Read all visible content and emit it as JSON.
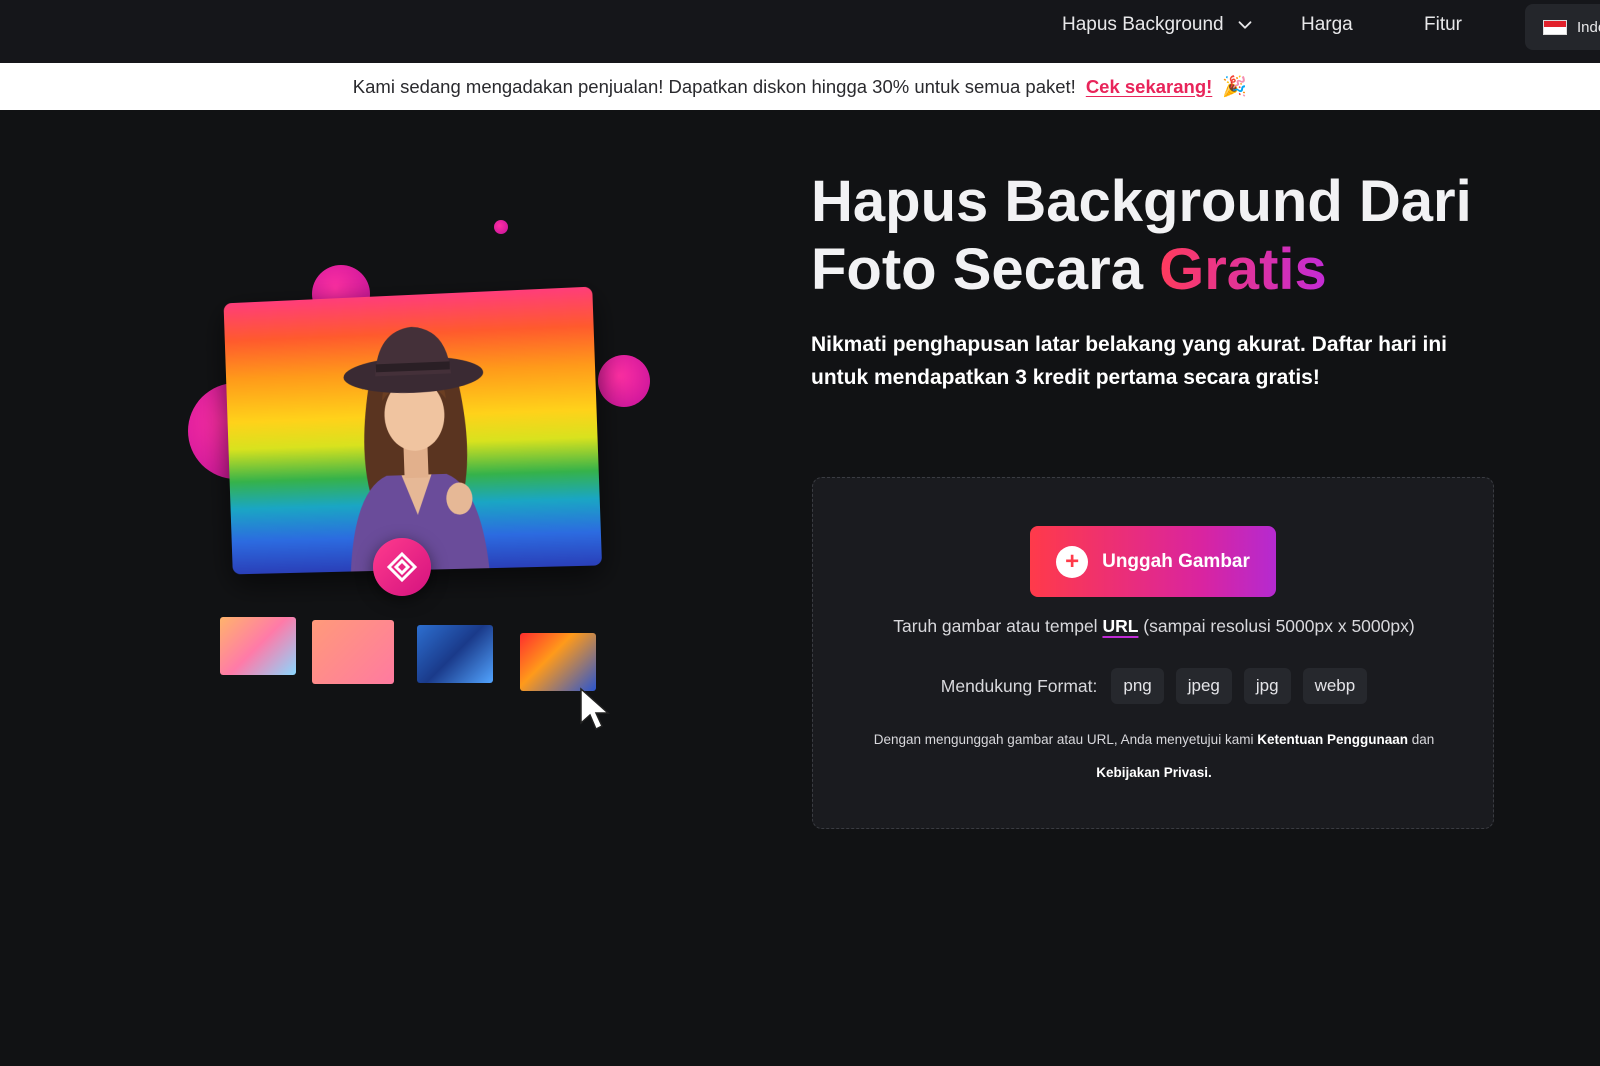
{
  "nav": {
    "items": [
      {
        "label": "Hapus Background"
      },
      {
        "label": "Harga"
      },
      {
        "label": "Fitur"
      }
    ],
    "language": "Indo"
  },
  "promo": {
    "text": "Kami sedang mengadakan penjualan! Dapatkan diskon hingga 30% untuk semua paket!",
    "link": "Cek sekarang!",
    "emoji": "🎉"
  },
  "hero": {
    "title_line1": "Hapus Background Dari",
    "title_line2": "Foto Secara",
    "title_highlight": "Gratis",
    "subtitle": "Nikmati penghapusan latar belakang yang akurat. Daftar hari ini untuk mendapatkan 3 kredit pertama secara gratis!"
  },
  "upload": {
    "button_label": "Unggah Gambar",
    "drop_prefix": "Taruh gambar atau tempel",
    "drop_link": "URL",
    "drop_suffix": "(sampai resolusi 5000px x 5000px)",
    "formats_label": "Mendukung Format:",
    "formats": [
      "png",
      "jpeg",
      "jpg",
      "webp"
    ],
    "terms_prefix": "Dengan mengunggah gambar atau URL, Anda menyetujui kami",
    "terms_link": "Ketentuan Penggunaan",
    "terms_and": "dan",
    "privacy_link": "Kebijakan Privasi."
  },
  "colors": {
    "accent_pink": "#e8245a",
    "gradient_start": "#ff3a4a",
    "gradient_end": "#b52ad0",
    "page_bg": "#111214"
  }
}
